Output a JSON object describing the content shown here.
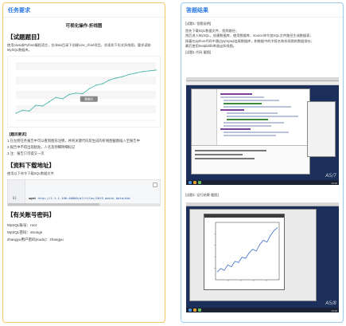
{
  "left": {
    "header": "任务要求",
    "task_title": "可视化操作-折线图",
    "sec_intro": "【试题题目】",
    "intro_text": "使用Java或Python编程语言，在/data目录下创建Line_chart项目，实现如下形式折线图，要求读取MySQL数据库。",
    "req_heading": "【题目要求】",
    "req_items": [
      "1.在左侧任务报告中可以看到图形注释，并将关键代码及生成的折线图截图插入至报告中",
      "2.报告中不得出现粘贴，人名及明细明细标记",
      "3.注：报告只可提交一次"
    ],
    "sec_download": "【资料下载地址】",
    "download_text": "使用以下命令下载SQL数据文件",
    "code_line_no": "01",
    "code_cmd": "wget",
    "code_url": "http://1.1.1.100:40000/allfiles/2019_match_data/dat",
    "sec_account": "【有关账号密码】",
    "account_lines": [
      "MySQL账号：root",
      "MySQL密码：strongs",
      "zhangyu用户密码(sudo)：zhangyu"
    ],
    "chart_tooltip": "数据点"
  },
  "right": {
    "header": "答题结果",
    "shot1_label": "[试题1: 答题说明]",
    "steps": [
      "首先下载SQL数据文件，找到路径；",
      "然后进入MySQL，创建数据库，使用数据库，source命令加SQL文件路径生成数据表；",
      "接着在python代码中通过pymysql连接数据库，和数据中的字段名和折线图的数据保存；",
      "最后使用matplotlib库画出折线图。"
    ],
    "code_label": "[试题1 代码 截图]",
    "shot2_label": "[试题1: 运行结果 截图]",
    "watermark1": "A5/7",
    "watermark2": "A5/8",
    "clock": "10:25"
  },
  "chart_data": {
    "type": "line",
    "title": "",
    "series": [
      {
        "name": "",
        "values": [
          1.0,
          1.4,
          1.3,
          2.1,
          2.0,
          2.6,
          3.2,
          3.0,
          3.6,
          3.8,
          3.7,
          4.4,
          4.9,
          5.1,
          5.6,
          5.9,
          6.1,
          6.4,
          6.6,
          6.8,
          6.9,
          7.0
        ]
      }
    ],
    "ylim": [
      0,
      8
    ],
    "grid": true,
    "color": "#4db6ac"
  },
  "chart_data_2": {
    "type": "line",
    "series": [
      {
        "name": "",
        "values": [
          1.0,
          1.6,
          1.3,
          2.2,
          1.9,
          2.8,
          2.6,
          3.5,
          3.3,
          4.2,
          4.8,
          4.5,
          5.6,
          6.3,
          6.0,
          7.1,
          7.9,
          8.4
        ]
      }
    ],
    "ylim": [
      0,
      9
    ],
    "color": "#3a6ec8"
  }
}
